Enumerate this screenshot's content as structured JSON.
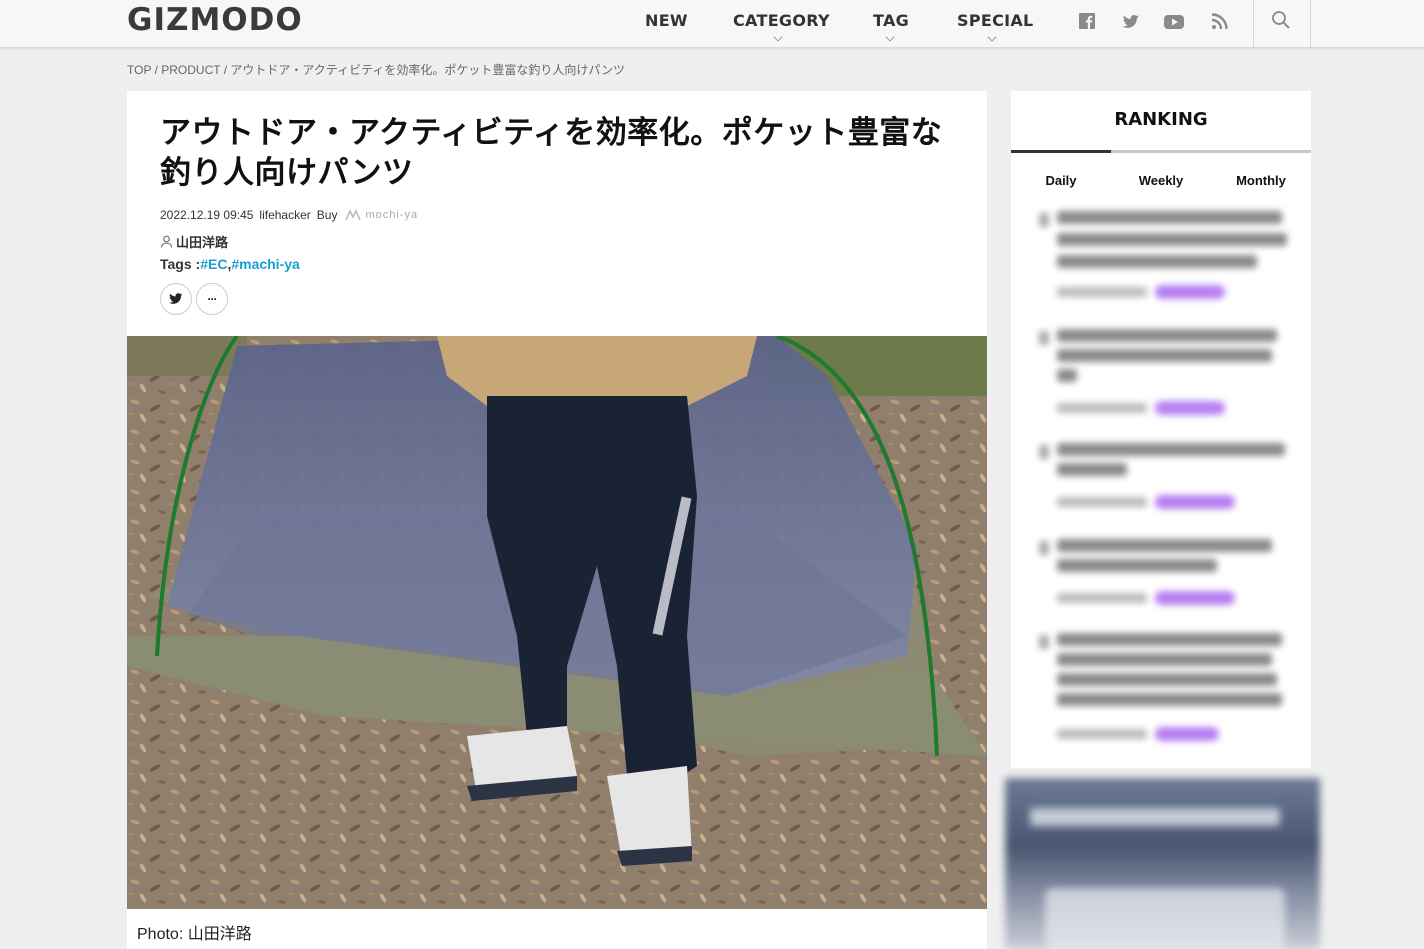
{
  "header": {
    "logo": "GIZMODO",
    "nav": [
      {
        "label": "NEW"
      },
      {
        "label": "CATEGORY"
      },
      {
        "label": "TAG"
      },
      {
        "label": "SPECIAL"
      }
    ],
    "social_icons": [
      "facebook-icon",
      "twitter-icon",
      "youtube-icon",
      "rss-icon"
    ],
    "search_icon": "search-icon"
  },
  "breadcrumb": {
    "top": "TOP",
    "sep1": " / ",
    "product": "PRODUCT",
    "sep2": " / ",
    "current": "アウトドア・アクティビティを効率化。ポケット豊富な釣り人向けパンツ"
  },
  "article": {
    "title": "アウトドア・アクティビティを効率化。ポケット豊富な釣り人向けパンツ",
    "datetime": "2022.12.19 09:45",
    "source": "lifehacker",
    "type": "Buy",
    "partner_logo": "mochi-ya",
    "author": "山田洋路",
    "tags_label": "Tags :",
    "tags": [
      "#EC",
      "#machi-ya"
    ],
    "tag_sep": ",",
    "share": {
      "twitter": "twitter-icon",
      "more": "···"
    },
    "caption": "Photo: 山田洋路"
  },
  "ranking": {
    "title": "RANKING",
    "tabs": [
      {
        "label": "Daily",
        "active": true
      },
      {
        "label": "Weekly",
        "active": false
      },
      {
        "label": "Monthly",
        "active": false
      }
    ]
  },
  "colors": {
    "accent_tag": "#1a9ed1",
    "category_pill": "#b77ff0"
  }
}
